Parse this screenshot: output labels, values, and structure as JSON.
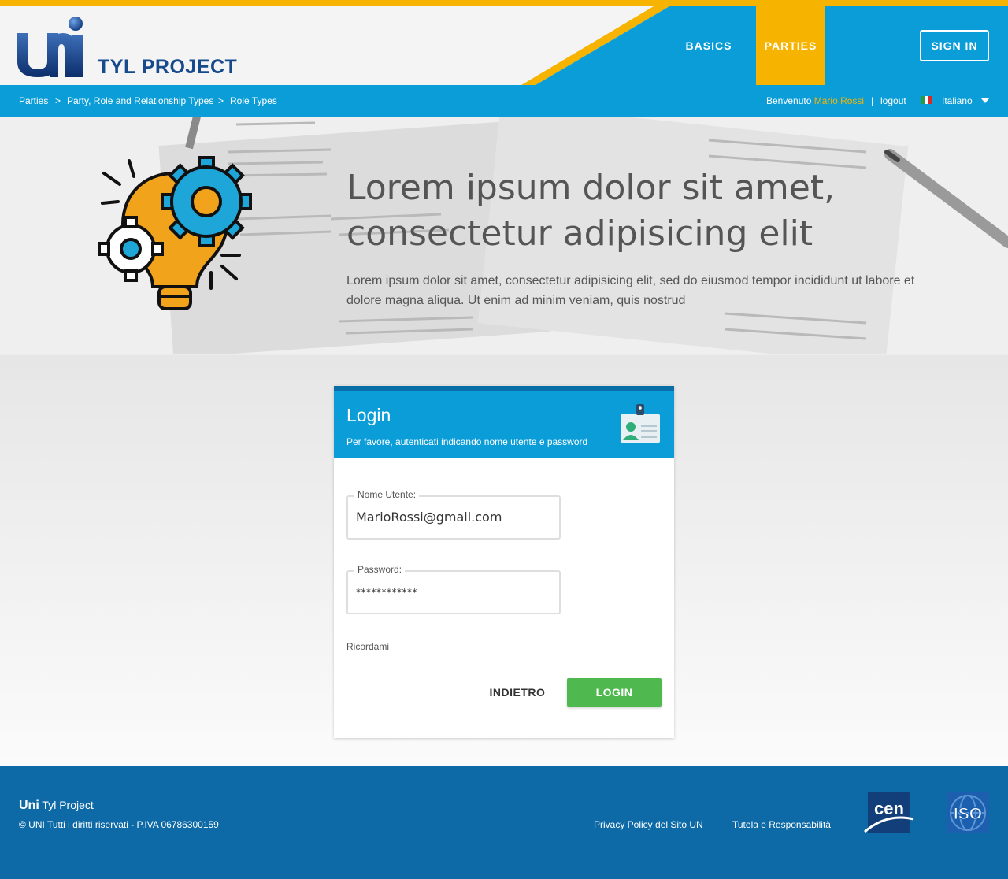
{
  "header": {
    "brand": "TYL PROJECT",
    "logo_text": "UNI",
    "nav": [
      {
        "label": "BASICS",
        "active": false
      },
      {
        "label": "PARTIES",
        "active": true
      }
    ],
    "sign_in_label": "SIGN IN"
  },
  "subbar": {
    "breadcrumbs": [
      "Parties",
      "Party, Role and Relationship Types",
      "Role Types"
    ],
    "separator": ">",
    "welcome_prefix": "Benvenuto",
    "user_name": "Mario Rossi",
    "divider": "|",
    "logout_label": "logout",
    "language": "Italiano",
    "flag_icon": "italy-flag-icon"
  },
  "hero": {
    "title": "Lorem ipsum dolor sit amet, consectetur adipisicing elit",
    "text": "Lorem ipsum dolor sit amet, consectetur adipisicing elit, sed do eiusmod tempor incididunt ut labore et dolore magna aliqua. Ut enim ad minim veniam, quis nostrud",
    "icon": "lightbulb-gears-icon"
  },
  "login": {
    "title": "Login",
    "subtitle": "Per favore, autenticati indicando nome utente e password",
    "badge_icon": "id-card-icon",
    "username_label": "Nome Utente:",
    "username_value": "MarioRossi@gmail.com",
    "password_label": "Password:",
    "password_value": "************",
    "remember_label": "Ricordami",
    "back_label": "INDIETRO",
    "login_label": "LOGIN"
  },
  "footer": {
    "brand_bold": "Uni",
    "brand_rest": "Tyl Project",
    "copyright": "© UNI Tutti i diritti riservati - P.IVA 06786300159",
    "privacy_label": "Privacy Policy del Sito UN",
    "tutela_label": "Tutela e Responsabilità",
    "cen_logo_text": "cen",
    "iso_logo_text": "ISO"
  },
  "colors": {
    "primary_blue": "#0b9dd8",
    "accent_yellow": "#f6b400",
    "footer_blue": "#0d6aa6",
    "login_green": "#4fb94f",
    "username_highlight": "#f6b400"
  }
}
